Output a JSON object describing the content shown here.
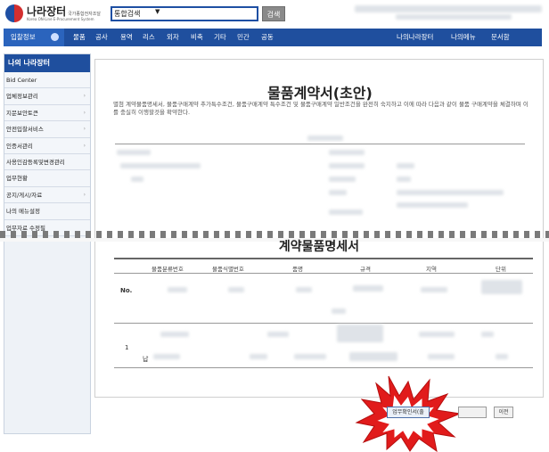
{
  "header": {
    "logo_title": "나라장터",
    "logo_subtitle": "국가종합전자조달",
    "logo_english": "Korea ON-Line E-Procurement System",
    "search_select": "통합검색",
    "search_button": "검색"
  },
  "nav": {
    "tab_label": "입찰정보",
    "items": [
      "물품",
      "공사",
      "용역",
      "리스",
      "외자",
      "비축",
      "기타",
      "민간",
      "공동"
    ],
    "right_items": [
      "나의나라장터",
      "나의메뉴",
      "문서함"
    ]
  },
  "sidebar": {
    "title": "나의 나라장터",
    "items": [
      {
        "label": "Bid Center",
        "arrow": false
      },
      {
        "label": "업체정보관리",
        "arrow": true
      },
      {
        "label": "지문보안토큰",
        "arrow": true
      },
      {
        "label": "안전입찰서비스",
        "arrow": true
      },
      {
        "label": "인증서관리",
        "arrow": true
      },
      {
        "label": "사용인감등록및변경관리",
        "arrow": false
      },
      {
        "label": "업무현황",
        "arrow": false
      },
      {
        "label": "공지/게시/자료",
        "arrow": true
      },
      {
        "label": "나의 메뉴설정",
        "arrow": false
      },
      {
        "label": "업무자료 수정필",
        "arrow": false
      }
    ]
  },
  "document": {
    "title": "물품계약서(초안)",
    "intro": "별첨 계약물품명세서, 물품구매계약 추가특수조건, 물품구매계약 특수조건 및 물품구매계약 일반조건을 완전히 숙지하고 이에 따라 다음과 같이 물품 구매계약을 체결하며 이를 충실히 이행할것을 확약한다.",
    "spec_title": "계약물품명세서",
    "spec_headers": [
      "물품분류번호",
      "물품식별번호",
      "품명",
      "규격",
      "지역",
      "단위"
    ],
    "no_label": "No.",
    "row_number": "1",
    "row_nap": "납"
  },
  "buttons": {
    "primary": "업무확인서(출",
    "middle": "",
    "next": "이전"
  },
  "colors": {
    "nav_bg": "#1f4f9e",
    "nav_tab": "#2b64bd",
    "burst_red": "#e11b1b"
  }
}
